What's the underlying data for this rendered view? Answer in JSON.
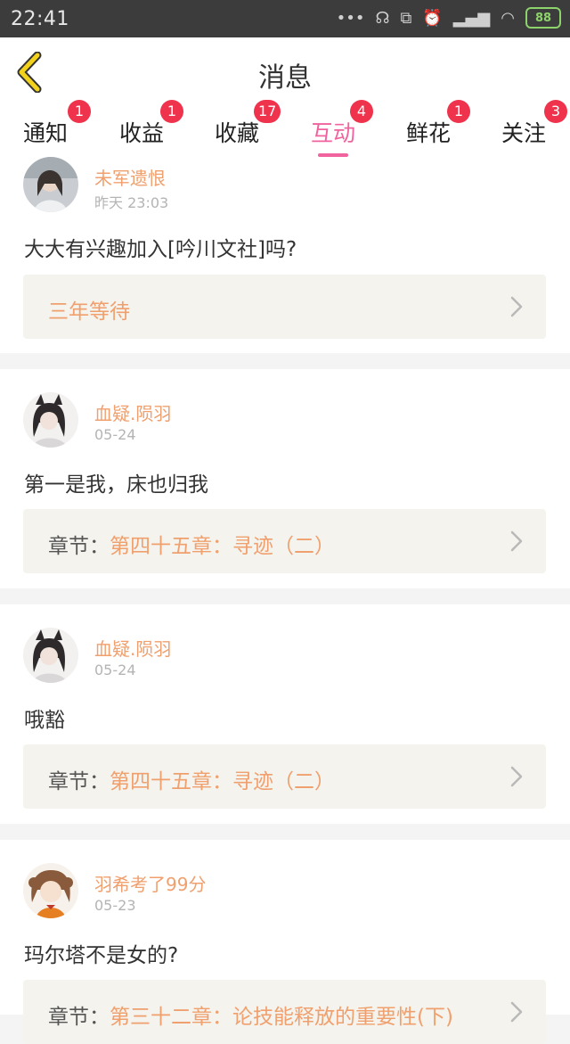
{
  "status": {
    "time": "22:41",
    "battery": "88"
  },
  "header": {
    "title": "消息"
  },
  "tabs": [
    {
      "label": "通知",
      "badge": "1"
    },
    {
      "label": "收益",
      "badge": "1"
    },
    {
      "label": "收藏",
      "badge": "17"
    },
    {
      "label": "互动",
      "badge": "4"
    },
    {
      "label": "鲜花",
      "badge": "1"
    },
    {
      "label": "关注",
      "badge": "3"
    }
  ],
  "active_tab": "互动",
  "messages": [
    {
      "user": "未军遗恨",
      "time": "昨天 23:03",
      "text": "大大有兴趣加入[吟川文社]吗?",
      "ref_prefix": "",
      "ref_value": "三年等待"
    },
    {
      "user": "血疑.陨羽",
      "time": "05-24",
      "text": "第一是我，床也归我",
      "ref_prefix": "章节：",
      "ref_value": "第四十五章：寻迹（二）"
    },
    {
      "user": "血疑.陨羽",
      "time": "05-24",
      "text": "哦豁",
      "ref_prefix": "章节：",
      "ref_value": "第四十五章：寻迹（二）"
    },
    {
      "user": "羽希考了99分",
      "time": "05-23",
      "text": "玛尔塔不是女的?",
      "ref_prefix": "章节：",
      "ref_value": "第三十二章：论技能释放的重要性(下)"
    }
  ],
  "colors": {
    "accent": "#f0639e",
    "badge": "#f0334c",
    "username": "#f0a06e",
    "back": "#f2d21b"
  }
}
